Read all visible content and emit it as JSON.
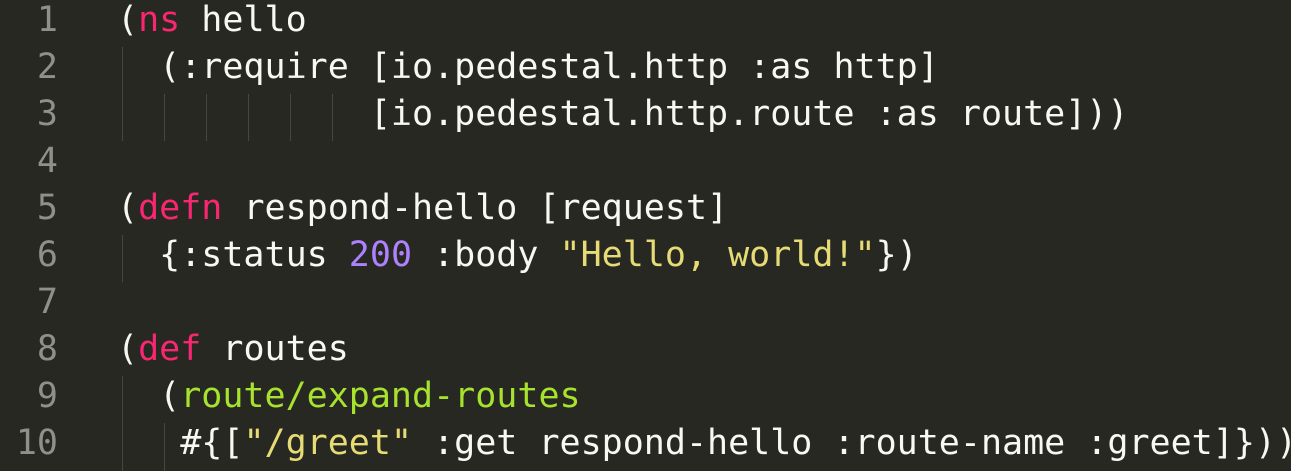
{
  "lines": [
    {
      "num": "1",
      "tokens": [
        {
          "t": "(",
          "c": "plain"
        },
        {
          "t": "ns",
          "c": "kw"
        },
        {
          "t": " hello",
          "c": "plain"
        }
      ]
    },
    {
      "num": "2",
      "tokens": [
        {
          "t": "  (:require [io.pedestal.http :as http]",
          "c": "plain"
        }
      ]
    },
    {
      "num": "3",
      "tokens": [
        {
          "t": "            [io.pedestal.http.route :as route]))",
          "c": "plain"
        }
      ]
    },
    {
      "num": "4",
      "tokens": []
    },
    {
      "num": "5",
      "tokens": [
        {
          "t": "(",
          "c": "plain"
        },
        {
          "t": "defn",
          "c": "kw"
        },
        {
          "t": " respond-hello [request]",
          "c": "plain"
        }
      ]
    },
    {
      "num": "6",
      "tokens": [
        {
          "t": "  {:status ",
          "c": "plain"
        },
        {
          "t": "200",
          "c": "num"
        },
        {
          "t": " :body ",
          "c": "plain"
        },
        {
          "t": "\"Hello, world!\"",
          "c": "str"
        },
        {
          "t": "})",
          "c": "plain"
        }
      ]
    },
    {
      "num": "7",
      "tokens": []
    },
    {
      "num": "8",
      "tokens": [
        {
          "t": "(",
          "c": "plain"
        },
        {
          "t": "def",
          "c": "kw"
        },
        {
          "t": " routes",
          "c": "plain"
        }
      ]
    },
    {
      "num": "9",
      "tokens": [
        {
          "t": "  (",
          "c": "plain"
        },
        {
          "t": "route/expand-routes",
          "c": "fn"
        }
      ]
    },
    {
      "num": "10",
      "tokens": [
        {
          "t": "   #{[",
          "c": "plain"
        },
        {
          "t": "\"/greet\"",
          "c": "str"
        },
        {
          "t": " :get respond-hello :route-name :greet]}))",
          "c": "plain"
        }
      ]
    }
  ],
  "colors": {
    "background": "#272822",
    "gutter_text": "#8f908a",
    "keyword": "#f92672",
    "plain": "#f8f8f2",
    "number": "#ae81ff",
    "string": "#e6db74",
    "function": "#a6e22e",
    "indent_guide": "#464741"
  }
}
